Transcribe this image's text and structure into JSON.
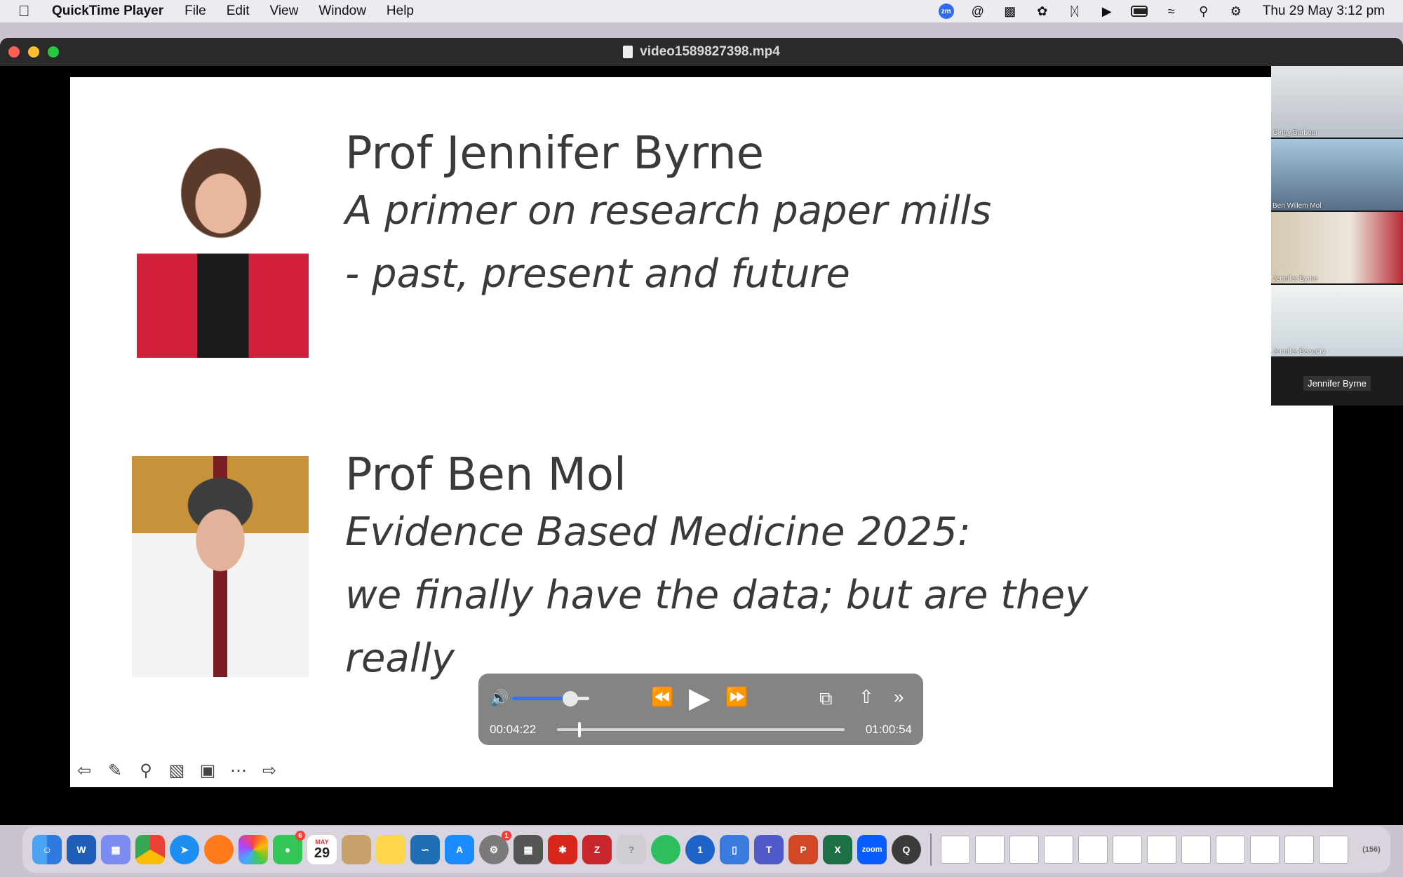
{
  "menubar": {
    "app_name": "QuickTime Player",
    "menus": [
      "File",
      "Edit",
      "View",
      "Window",
      "Help"
    ],
    "clock": "Thu 29 May  3:12 pm",
    "battery_level": 0.7
  },
  "window": {
    "title": "video1589827398.mp4"
  },
  "slide": {
    "speaker1": {
      "name": "Prof Jennifer Byrne",
      "line1": "A primer on research paper mills",
      "line2": "- past, present and future"
    },
    "speaker2": {
      "name": "Prof Ben Mol",
      "line1": "Evidence Based Medicine 2025:",
      "line2": "we finally have the data; but are they",
      "line3": "really"
    }
  },
  "participants": {
    "tiles": [
      "Ginny Barbour",
      "Ben Willem Mol",
      "Jennifer Byrne",
      "Jennifer Beaudry"
    ],
    "active_speaker": "Jennifer Byrne"
  },
  "player": {
    "current_time": "00:04:22",
    "total_time": "01:00:54",
    "volume": 0.75,
    "progress": 0.072
  },
  "dock": {
    "calendar_month": "MAY",
    "calendar_day": "29",
    "messages_badge": "6",
    "settings_badge": "1",
    "zoom_label": "zoom",
    "trash_count": "(156)"
  },
  "colors": {
    "accent": "#1f7aff",
    "menubar_bg": "#ecebf0",
    "titlebar_bg": "#2a2a2a"
  }
}
